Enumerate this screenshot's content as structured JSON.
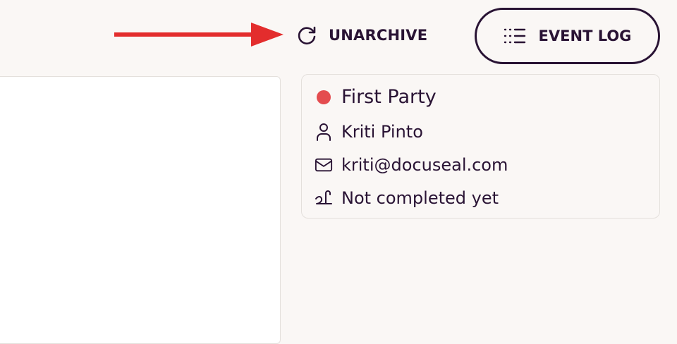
{
  "colors": {
    "background": "#faf7f5",
    "text": "#291334",
    "party_dot": "#e44c4f",
    "annotation_arrow": "#e32d2d"
  },
  "toolbar": {
    "unarchive_label": "UNARCHIVE",
    "unarchive_icon": "refresh-icon",
    "event_log_label": "EVENT LOG",
    "event_log_icon": "list-icon"
  },
  "party": {
    "name": "First Party",
    "signer_name": "Kriti Pinto",
    "email": "kriti@docuseal.com",
    "status": "Not completed yet",
    "icons": [
      "status-dot-icon",
      "user-icon",
      "mail-icon",
      "signature-icon"
    ]
  }
}
